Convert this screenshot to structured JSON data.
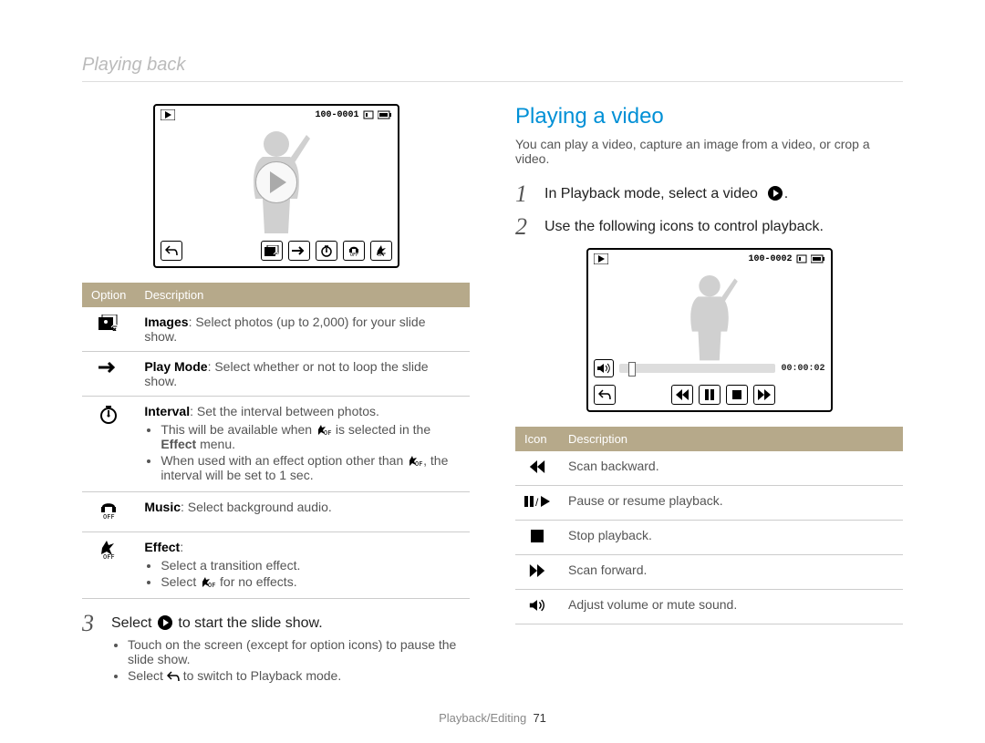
{
  "header": "Playing back",
  "footer": {
    "section": "Playback/Editing",
    "page": "71"
  },
  "left": {
    "lcd": {
      "file_counter": "100-0001"
    },
    "table": {
      "head": {
        "col1": "Option",
        "col2": "Description"
      },
      "rows": [
        {
          "icon": "images-icon",
          "title": "Images",
          "desc": ": Select photos (up to 2,000) for your slide show."
        },
        {
          "icon": "play-mode-icon",
          "title": "Play Mode",
          "desc": ": Select whether or not to loop the slide show."
        },
        {
          "icon": "interval-icon",
          "title": "Interval",
          "desc": ": Set the interval between photos.",
          "bullets": [
            "This will be available when ⋆OFF is selected in the Effect menu.",
            "When used with an effect option other than ⋆OFF, the interval will be set to 1 sec."
          ],
          "boldword": "Effect"
        },
        {
          "icon": "music-icon",
          "title": "Music",
          "desc": ": Select background audio."
        },
        {
          "icon": "effect-icon",
          "title": "Effect",
          "desc": ":",
          "bullets": [
            "Select a transition effect.",
            "Select ⋆OFF for no effects."
          ]
        }
      ]
    },
    "step": {
      "num": "3",
      "text": "Select  ▶  to start the slide show.",
      "bullets": [
        "Touch on the screen (except for option icons) to pause the slide show.",
        "Select ↩ to switch to Playback mode."
      ]
    }
  },
  "right": {
    "title": "Playing a video",
    "intro": "You can play a video, capture an image from a video, or crop a video.",
    "steps": [
      {
        "num": "1",
        "text": "In Playback mode, select a video  ▶."
      },
      {
        "num": "2",
        "text": "Use the following icons to control playback."
      }
    ],
    "lcd": {
      "file_counter": "100-0002",
      "time": "00:00:02"
    },
    "table": {
      "head": {
        "col1": "Icon",
        "col2": "Description"
      },
      "rows": [
        {
          "icon": "rewind-icon",
          "desc": "Scan backward."
        },
        {
          "icon": "pause-play-icon",
          "desc": "Pause or resume playback."
        },
        {
          "icon": "stop-icon",
          "desc": "Stop playback."
        },
        {
          "icon": "forward-icon",
          "desc": "Scan forward."
        },
        {
          "icon": "volume-icon",
          "desc": "Adjust volume or mute sound."
        }
      ]
    }
  }
}
